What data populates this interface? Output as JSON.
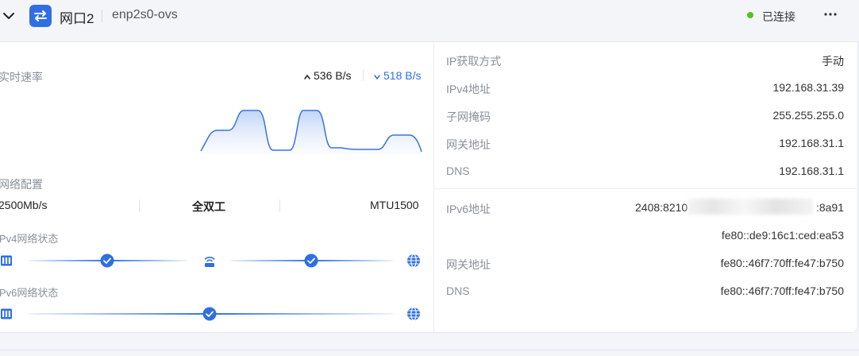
{
  "header": {
    "title": "网口2",
    "device": "enp2s0-ovs",
    "status": "已连接",
    "status_color": "#52c41a",
    "accent_color": "#2f6fe4",
    "collapse_icon": "chevron-down-icon",
    "iface_icon": "swap-arrows-icon",
    "more_icon": "more-dots-icon"
  },
  "speed": {
    "label": "实时速率",
    "upload": "536 B/s",
    "download": "518 B/s",
    "upload_icon": "arrow-up-icon",
    "download_icon": "arrow-down-icon"
  },
  "network_config": {
    "label": "网络配置",
    "rate": "2500Mb/s",
    "duplex": "全双工",
    "mtu": "MTU1500"
  },
  "ipv4_status": {
    "label": "Pv4网络状态",
    "icons": [
      "port-icon",
      "check-icon",
      "router-icon",
      "check-icon",
      "globe-icon"
    ]
  },
  "ipv6_status": {
    "label": "Pv6网络状态",
    "icons": [
      "port-icon",
      "check-icon",
      "globe-icon"
    ]
  },
  "ipv4": {
    "rows": [
      {
        "label": "IP获取方式",
        "value": "手动"
      },
      {
        "label": "IPv4地址",
        "value": "192.168.31.39"
      },
      {
        "label": "子网掩码",
        "value": "255.255.255.0"
      },
      {
        "label": "网关地址",
        "value": "192.168.31.1"
      },
      {
        "label": "DNS",
        "value": "192.168.31.1"
      }
    ]
  },
  "ipv6": {
    "address_label": "IPv6地址",
    "address_prefix": "2408:8210",
    "address_suffix": ":8a91",
    "link_local": "fe80::de9:16c1:ced:ea53",
    "gateway_label": "网关地址",
    "gateway": "fe80::46f7:70ff:fe47:b750",
    "dns_label": "DNS",
    "dns": "fe80::46f7:70ff:fe47:b750"
  }
}
